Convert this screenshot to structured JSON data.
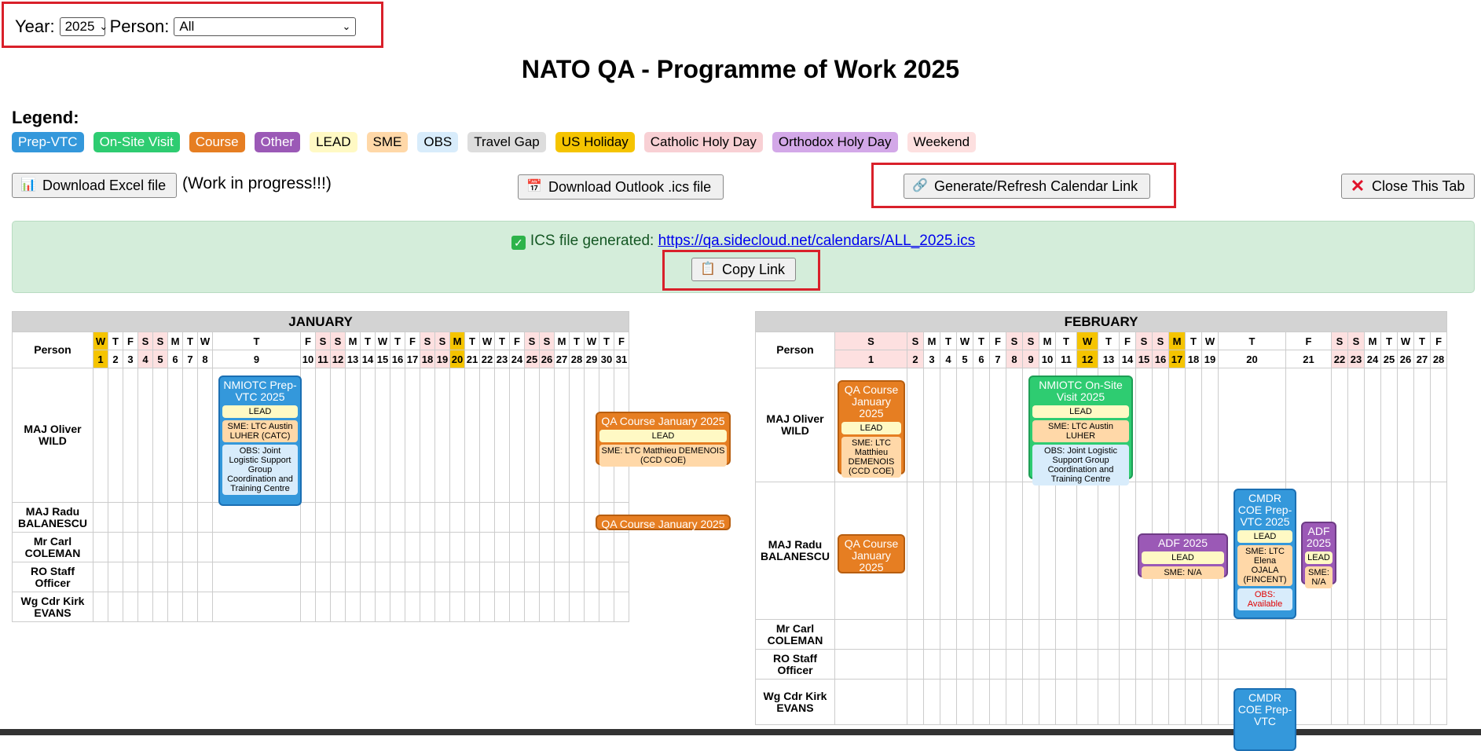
{
  "filters": {
    "year_label": "Year:",
    "year_value": "2025",
    "person_label": "Person:",
    "person_value": "All"
  },
  "title": "NATO QA - Programme of Work 2025",
  "legend": {
    "title": "Legend:",
    "items": [
      {
        "label": "Prep-VTC",
        "bg": "#3498db",
        "fg": "#ffffff"
      },
      {
        "label": "On-Site Visit",
        "bg": "#2ecc71",
        "fg": "#ffffff"
      },
      {
        "label": "Course",
        "bg": "#e67e22",
        "fg": "#ffffff"
      },
      {
        "label": "Other",
        "bg": "#9b59b6",
        "fg": "#ffffff"
      },
      {
        "label": "LEAD",
        "bg": "#fff9c4",
        "fg": "#000000"
      },
      {
        "label": "SME",
        "bg": "#ffd8a8",
        "fg": "#000000"
      },
      {
        "label": "OBS",
        "bg": "#d8ecfb",
        "fg": "#000000"
      },
      {
        "label": "Travel Gap",
        "bg": "#dddddd",
        "fg": "#000000"
      },
      {
        "label": "US Holiday",
        "bg": "#f5c400",
        "fg": "#000000"
      },
      {
        "label": "Catholic Holy Day",
        "bg": "#f8d0d4",
        "fg": "#000000"
      },
      {
        "label": "Orthodox Holy Day",
        "bg": "#d3a8e8",
        "fg": "#000000"
      },
      {
        "label": "Weekend",
        "bg": "#fde0e0",
        "fg": "#000000"
      }
    ]
  },
  "actions": {
    "excel_label": "Download Excel file",
    "excel_note": "(Work in progress!!!)",
    "outlook_label": "Download Outlook .ics file",
    "generate_label": "Generate/Refresh Calendar Link",
    "close_label": "Close This Tab"
  },
  "ics": {
    "prefix": "ICS file generated:",
    "link": "https://qa.sidecloud.net/calendars/ALL_2025.ics",
    "copy_label": "Copy Link"
  },
  "calendar": {
    "person_header": "Person",
    "people": [
      "MAJ Oliver WILD",
      "MAJ Radu BALANESCU",
      "Mr Carl COLEMAN",
      "RO Staff Officer",
      "Wg Cdr Kirk EVANS"
    ],
    "january": {
      "name": "JANUARY",
      "dows": [
        "W",
        "T",
        "F",
        "S",
        "S",
        "M",
        "T",
        "W",
        "T",
        "F",
        "S",
        "S",
        "M",
        "T",
        "W",
        "T",
        "F",
        "S",
        "S",
        "M",
        "T",
        "W",
        "T",
        "F",
        "S",
        "S",
        "M",
        "T",
        "W",
        "T",
        "F"
      ],
      "weekend_days": [
        4,
        5,
        11,
        12,
        18,
        19,
        25,
        26
      ],
      "holiday_days": [
        1,
        20
      ],
      "events": [
        {
          "title": "NMIOTC Prep-VTC 2025",
          "lead": "LEAD",
          "sme": "SME: LTC Austin LUHER (CATC)",
          "obs": "OBS: Joint Logistic Support Group Coordination and Training Centre"
        },
        {
          "title": "QA Course January 2025",
          "lead": "LEAD",
          "sme": "SME: LTC Matthieu DEMENOIS (CCD COE)"
        },
        {
          "title": "QA Course January 2025"
        }
      ]
    },
    "february": {
      "name": "FEBRUARY",
      "dows": [
        "S",
        "S",
        "M",
        "T",
        "W",
        "T",
        "F",
        "S",
        "S",
        "M",
        "T",
        "W",
        "T",
        "F",
        "S",
        "S",
        "M",
        "T",
        "W",
        "T",
        "F",
        "S",
        "S",
        "M",
        "T",
        "W",
        "T",
        "F"
      ],
      "weekend_days": [
        1,
        2,
        8,
        9,
        15,
        16,
        22,
        23
      ],
      "holiday_days": [
        12,
        17
      ],
      "events": [
        {
          "title": "QA Course January 2025",
          "lead": "LEAD",
          "sme": "SME: LTC Matthieu DEMENOIS (CCD COE)"
        },
        {
          "title": "NMIOTC On-Site Visit 2025",
          "lead": "LEAD",
          "sme": "SME: LTC Austin LUHER",
          "obs": "OBS: Joint Logistic Support Group Coordination and Training Centre"
        },
        {
          "title": "QA Course January 2025"
        },
        {
          "title": "ADF 2025",
          "lead": "LEAD",
          "sme": "SME: N/A"
        },
        {
          "title": "CMDR COE Prep-VTC 2025",
          "lead": "LEAD",
          "sme": "SME: LTC Elena OJALA (FINCENT)",
          "obs": "OBS: Available"
        },
        {
          "title": "ADF 2025",
          "lead": "LEAD",
          "sme": "SME: N/A"
        },
        {
          "title": "CMDR COE Prep-VTC"
        }
      ]
    }
  }
}
